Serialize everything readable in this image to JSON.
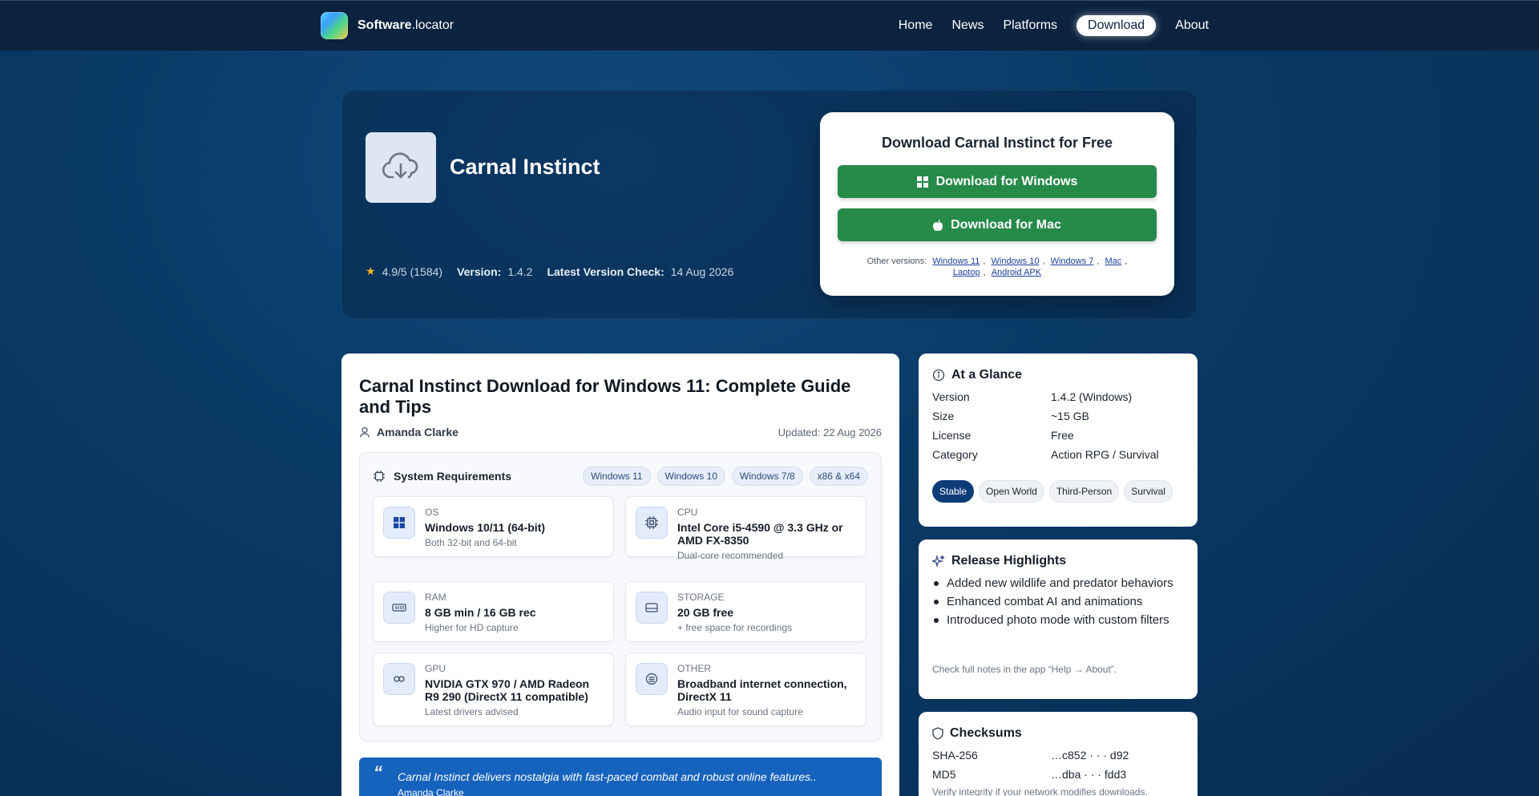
{
  "nav": {
    "brand_bold": "Software",
    "brand_rest": ".locator",
    "links": [
      "Home",
      "News",
      "Platforms",
      "Download",
      "About"
    ]
  },
  "hero": {
    "app_name": "Carnal Instinct",
    "rating": "4.9/5",
    "rating_count": "(1584)",
    "version_label": "Version:",
    "version": "1.4.2",
    "check_label": "Latest Version Check:",
    "check_date": "14 Aug 2026",
    "download": {
      "title": "Download Carnal Instinct for Free",
      "windows_label": "Download for Windows",
      "mac_label": "Download for Mac",
      "other_label": "Other versions:",
      "other_versions": [
        "Windows 11",
        "Windows 10",
        "Windows 7",
        "Mac",
        "Laptop",
        "Android APK"
      ]
    }
  },
  "article": {
    "title": "Carnal Instinct Download for Windows 11: Complete Guide and Tips",
    "author": "Amanda Clarke",
    "updated": "Updated: 22 Aug 2026",
    "sysreq": {
      "title": "System Requirements",
      "chips": [
        "Windows 11",
        "Windows 10",
        "Windows 7/8",
        "x86 & x64"
      ],
      "items": [
        {
          "label": "OS",
          "value": "Windows 10/11 (64-bit)",
          "note": "Both 32-bit and 64-bit",
          "icon": "windows-icon"
        },
        {
          "label": "CPU",
          "value": "Intel Core i5-4590 @ 3.3 GHz or AMD FX-8350",
          "note": "Dual-core recommended",
          "icon": "cpu-icon"
        },
        {
          "label": "RAM",
          "value": "8 GB min / 16 GB rec",
          "note": "Higher for HD capture",
          "icon": "ram-icon"
        },
        {
          "label": "STORAGE",
          "value": "20 GB free",
          "note": "+ free space for recordings",
          "icon": "storage-icon"
        },
        {
          "label": "GPU",
          "value": "NVIDIA GTX 970 / AMD Radeon R9 290 (DirectX 11 compatible)",
          "note": "Latest drivers advised",
          "icon": "gpu-icon"
        },
        {
          "label": "OTHER",
          "value": "Broadband internet connection, DirectX 11",
          "note": "Audio input for sound capture",
          "icon": "other-icon"
        }
      ]
    },
    "quote": {
      "mark": "“",
      "text": "Carnal Instinct delivers nostalgia with fast-paced combat and robust online features..",
      "by": "Amanda Clarke"
    }
  },
  "glance": {
    "title": "At a Glance",
    "rows": [
      {
        "k": "Version",
        "v": "1.4.2 (Windows)"
      },
      {
        "k": "Size",
        "v": "~15 GB"
      },
      {
        "k": "License",
        "v": "Free"
      },
      {
        "k": "Category",
        "v": "Action RPG / Survival"
      }
    ],
    "tags": [
      "Stable",
      "Open World",
      "Third-Person",
      "Survival"
    ]
  },
  "highlights": {
    "title": "Release Highlights",
    "items": [
      "Added new wildlife and predator behaviors",
      "Enhanced combat AI and animations",
      "Introduced photo mode with custom filters"
    ],
    "note": "Check full notes in the app “Help → About”."
  },
  "checksums": {
    "title": "Checksums",
    "rows": [
      {
        "k": "SHA-256",
        "v": "…c852 · · · d92"
      },
      {
        "k": "MD5",
        "v": "…dba · · · fdd3"
      }
    ],
    "note": "Verify integrity if your network modifies downloads."
  }
}
